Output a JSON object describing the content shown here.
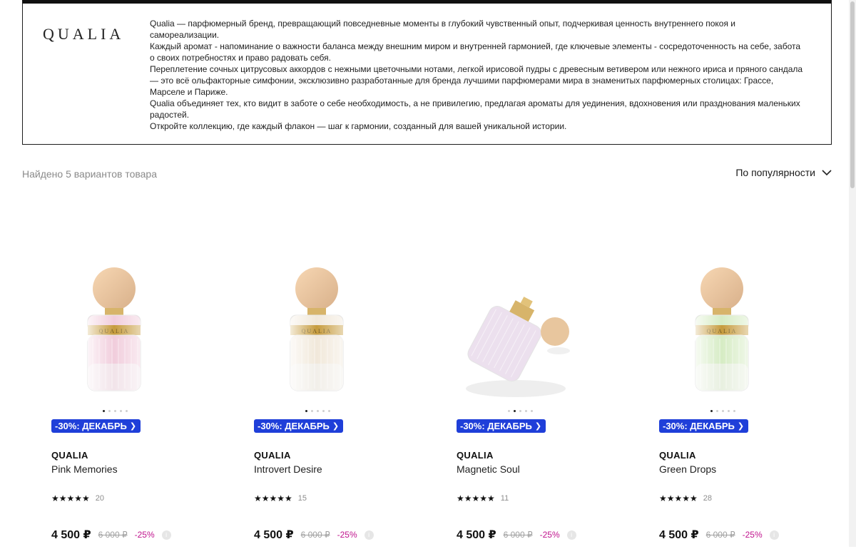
{
  "brand_block": {
    "logo": "QUALIA",
    "paragraphs": [
      "Qualia — парфюмерный бренд, превращающий повседневные моменты в глубокий чувственный опыт, подчеркивая ценность внутреннего покоя и самореализации.",
      "Каждый аромат - напоминание о важности баланса между внешним миром и внутренней гармонией, где ключевые элементы - сосредоточенность на себе, забота о своих потребностях и право радовать себя.",
      "Переплетение сочных цитрусовых аккордов с нежными цветочными нотами, легкой ирисовой пудры с древесным ветивером или нежного ириса и пряного сандала — это всё ольфакторные симфонии, эксклюзивно разработанные для бренда лучшими парфюмерами мира в знаменитых парфюмерных столицах: Грассе, Марселе и Париже.",
      "Qualia объединяет тех, кто видит в заботе о себе необходимость, а не привилегию, предлагая ароматы для уединения, вдохновения или празднования маленьких радостей.",
      "Откройте коллекцию, где каждый флакон — шаг к гармонии, созданный для вашей уникальной истории."
    ]
  },
  "listing": {
    "found_text": "Найдено 5 вариантов товара",
    "sort_label": "По популярности"
  },
  "colors": {
    "promo_bg": "#1f3fd9",
    "discount": "#c0148e"
  },
  "products": [
    {
      "promo": "-30%: ДЕКАБРЬ",
      "brand": "QUALIA",
      "name": "Pink Memories",
      "stars": "★★★★★",
      "rating_count": "20",
      "price": "4 500 ₽",
      "old_price": "6 000 ₽",
      "discount": "-25%",
      "bottle_label": "QUALIA",
      "liquid_color": "#f1cddc",
      "active_dot": 0
    },
    {
      "promo": "-30%: ДЕКАБРЬ",
      "brand": "QUALIA",
      "name": "Introvert Desire",
      "stars": "★★★★★",
      "rating_count": "15",
      "price": "4 500 ₽",
      "old_price": "6 000 ₽",
      "discount": "-25%",
      "bottle_label": "QUALIA",
      "liquid_color": "#f1e8da",
      "active_dot": 0
    },
    {
      "promo": "-30%: ДЕКАБРЬ",
      "brand": "QUALIA",
      "name": "Magnetic Soul",
      "stars": "★★★★★",
      "rating_count": "11",
      "price": "4 500 ₽",
      "old_price": "6 000 ₽",
      "discount": "-25%",
      "bottle_label": "",
      "liquid_color": "#ece0ee",
      "active_dot": 1
    },
    {
      "promo": "-30%: ДЕКАБРЬ",
      "brand": "QUALIA",
      "name": "Green Drops",
      "stars": "★★★★★",
      "rating_count": "28",
      "price": "4 500 ₽",
      "old_price": "6 000 ₽",
      "discount": "-25%",
      "bottle_label": "QUALIA",
      "liquid_color": "#d6ecc4",
      "active_dot": 0
    }
  ]
}
